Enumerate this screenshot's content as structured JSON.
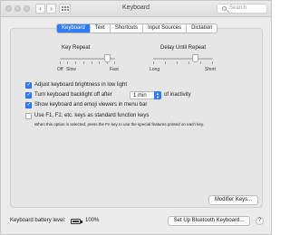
{
  "window": {
    "title": "Keyboard"
  },
  "toolbar": {
    "search_placeholder": "Search"
  },
  "tabs": [
    "Keyboard",
    "Text",
    "Shortcuts",
    "Input Sources",
    "Dictation"
  ],
  "key_repeat": {
    "title": "Key Repeat",
    "left_labels": [
      "Off",
      "Slow"
    ],
    "right_label": "Fast",
    "level": 0.86
  },
  "delay_until_repeat": {
    "title": "Delay Until Repeat",
    "left_label": "Long",
    "right_label": "Short",
    "level": 0.71
  },
  "options": [
    {
      "label": "Adjust keyboard brightness in low light",
      "checked": true
    },
    {
      "label": "Turn keyboard backlight off after",
      "checked": true,
      "value": "1 min",
      "suffix": "of inactivity"
    },
    {
      "label": "Show keyboard and emoji viewers in menu bar",
      "checked": true
    },
    {
      "label": "Use F1, F2, etc. keys as standard function keys",
      "checked": false,
      "note": "When this option is selected, press the Fn key to use the special features printed on each key."
    }
  ],
  "buttons": {
    "modifier_keys": "Modifier Keys...",
    "bluetooth": "Set Up Bluetooth Keyboard...",
    "help": "?"
  },
  "battery": {
    "label": "Keyboard battery level:",
    "value": "100%"
  }
}
